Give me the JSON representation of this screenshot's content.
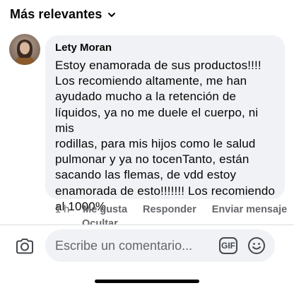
{
  "sort": {
    "label": "Más relevantes",
    "icon": "chevron-down-icon"
  },
  "comment": {
    "author": "Lety Moran",
    "text": "Estoy enamorada de sus productos!!!!\nLos recomiendo altamente, me han\nayudado mucho a la retención de\nlíquidos, ya no me duele el cuerpo, ni mis\nrodillas, para mis hijos como le salud\npulmonar y ya no tocenTanto, están\nsacando las flemas, de vdd estoy\nenamorada de esto!!!!!!! Los recomiendo\nal 1000%",
    "time": "1 h",
    "actions": {
      "like": "Me gusta",
      "reply": "Responder",
      "send": "Enviar mensaje"
    },
    "hide": "Ocultar"
  },
  "composer": {
    "placeholder": "Escribe un comentario...",
    "gif_label": "GIF",
    "camera_icon": "camera-icon",
    "emoji_icon": "emoji-icon"
  },
  "colors": {
    "bubble": "#f0f2f5",
    "secondary_text": "#65676b",
    "primary_text": "#050505"
  }
}
